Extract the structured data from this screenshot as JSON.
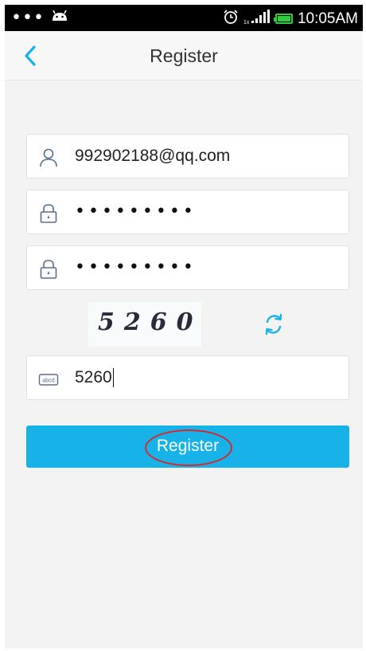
{
  "status_bar": {
    "left_dots": "•••",
    "time": "10:05AM",
    "network_label": "1x"
  },
  "nav": {
    "title": "Register",
    "back_icon": "chevron-left-icon"
  },
  "form": {
    "email_value": "992902188@qq.com",
    "password_mask": "•••••••••",
    "confirm_password_mask": "•••••••••",
    "captcha_image_text": "5260",
    "captcha_input_value": "5260",
    "captcha_field_icon_text": "abcd"
  },
  "button": {
    "register_label": "Register"
  },
  "colors": {
    "accent": "#17b3e8",
    "icon": "#5a6d8f",
    "annotation": "#d9262c"
  }
}
